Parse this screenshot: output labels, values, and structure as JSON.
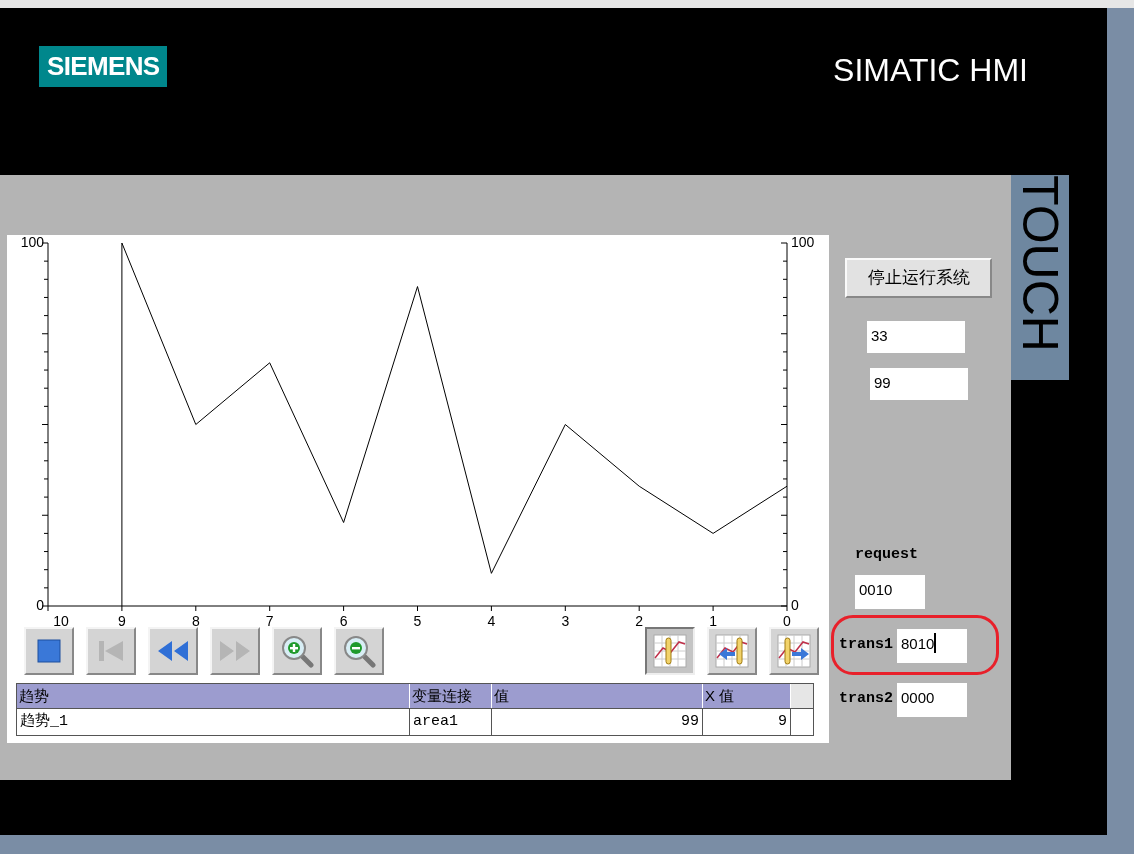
{
  "header": {
    "logo": "SIEMENS",
    "product": "SIMATIC HMI",
    "side_label": "TOUCH"
  },
  "trend": {
    "chart_data": {
      "type": "line",
      "categories": [
        "10",
        "9",
        "8",
        "7",
        "6",
        "5",
        "4",
        "3",
        "2",
        "1",
        "0"
      ],
      "ylim": [
        0,
        100
      ],
      "yticks": [
        0,
        100
      ],
      "series": [
        {
          "color": "#000000",
          "values": [
            null,
            100,
            50,
            67,
            23,
            88,
            9,
            50,
            33,
            20,
            33
          ]
        }
      ],
      "ref_lines": [
        {
          "axis": "x",
          "value": "9"
        }
      ]
    },
    "right_axis_labels": [
      "100",
      "0"
    ],
    "toolbar": [
      {
        "kind": "stop",
        "disabled": false
      },
      {
        "kind": "first",
        "disabled": true
      },
      {
        "kind": "back",
        "disabled": false
      },
      {
        "kind": "forward",
        "disabled": true
      },
      {
        "kind": "zoom_in",
        "disabled": false
      },
      {
        "kind": "zoom_out",
        "disabled": false
      }
    ],
    "ruler_toolbar": [
      {
        "kind": "ruler",
        "selected": true
      },
      {
        "kind": "ruler_left",
        "selected": false
      },
      {
        "kind": "ruler_right",
        "selected": false
      }
    ],
    "table": {
      "columns": [
        "趋势",
        "变量连接",
        "值",
        "X 值"
      ],
      "rows": [
        [
          "趋势_1",
          "area1",
          "99",
          "9"
        ]
      ]
    }
  },
  "stop_button": "停止运行系统",
  "outputs": [
    "33",
    "99"
  ],
  "fields": [
    {
      "kind": "stacked",
      "label": "request",
      "value": "0010",
      "focused": false,
      "highlighted": false
    },
    {
      "kind": "inline",
      "label": "trans1",
      "value": "8010",
      "focused": true,
      "highlighted": true
    },
    {
      "kind": "inline",
      "label": "trans2",
      "value": "0000",
      "focused": false,
      "highlighted": false
    }
  ]
}
